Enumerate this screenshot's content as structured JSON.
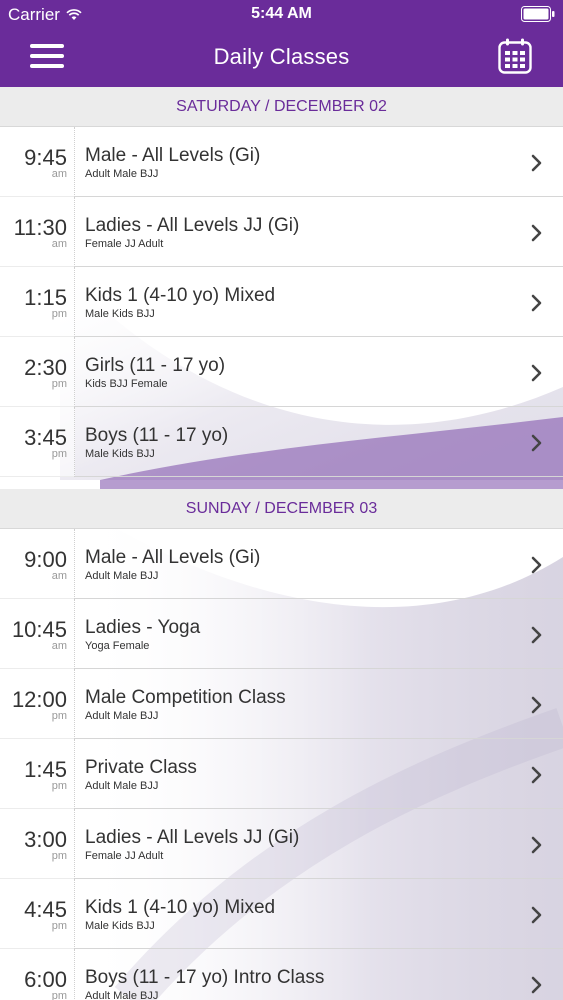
{
  "status_bar": {
    "carrier": "Carrier",
    "time": "5:44 AM"
  },
  "nav": {
    "title": "Daily Classes",
    "menu_icon": "hamburger-menu-icon",
    "calendar_icon": "calendar-icon"
  },
  "colors": {
    "brand": "#6a2c9a",
    "section_bg": "#ececec",
    "text": "#333333",
    "muted": "#999999"
  },
  "days": [
    {
      "label": "SATURDAY / DECEMBER 02",
      "classes": [
        {
          "time": "9:45",
          "ampm": "am",
          "title": "Male - All Levels (Gi)",
          "subtitle": "Adult Male BJJ"
        },
        {
          "time": "11:30",
          "ampm": "am",
          "title": "Ladies - All Levels JJ (Gi)",
          "subtitle": "Female JJ Adult"
        },
        {
          "time": "1:15",
          "ampm": "pm",
          "title": "Kids 1 (4-10 yo) Mixed",
          "subtitle": "Male Kids BJJ"
        },
        {
          "time": "2:30",
          "ampm": "pm",
          "title": "Girls (11 - 17 yo)",
          "subtitle": "Kids BJJ Female"
        },
        {
          "time": "3:45",
          "ampm": "pm",
          "title": "Boys (11 - 17 yo)",
          "subtitle": "Male Kids BJJ"
        }
      ]
    },
    {
      "label": "SUNDAY / DECEMBER 03",
      "classes": [
        {
          "time": "9:00",
          "ampm": "am",
          "title": "Male - All Levels (Gi)",
          "subtitle": "Adult Male BJJ"
        },
        {
          "time": "10:45",
          "ampm": "am",
          "title": "Ladies - Yoga",
          "subtitle": "Yoga Female"
        },
        {
          "time": "12:00",
          "ampm": "pm",
          "title": "Male Competition Class",
          "subtitle": "Adult Male BJJ"
        },
        {
          "time": "1:45",
          "ampm": "pm",
          "title": "Private Class",
          "subtitle": "Adult Male BJJ"
        },
        {
          "time": "3:00",
          "ampm": "pm",
          "title": "Ladies - All Levels JJ (Gi)",
          "subtitle": "Female JJ Adult"
        },
        {
          "time": "4:45",
          "ampm": "pm",
          "title": "Kids 1 (4-10 yo) Mixed",
          "subtitle": "Male Kids BJJ"
        },
        {
          "time": "6:00",
          "ampm": "pm",
          "title": "Boys (11 - 17 yo) Intro Class",
          "subtitle": "Adult Male BJJ"
        }
      ]
    }
  ]
}
